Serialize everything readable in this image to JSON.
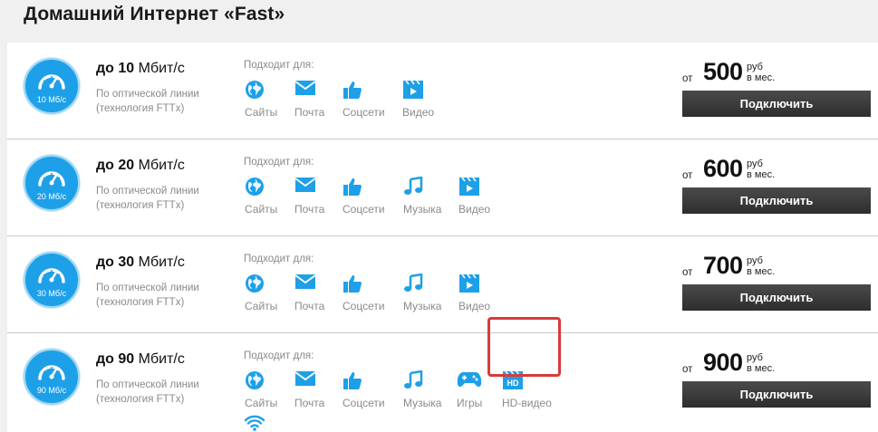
{
  "page": {
    "title": "Домашний Интернет «Fast»"
  },
  "colors": {
    "accent": "#1ea0e8",
    "button": "#3a3a3a",
    "highlight": "#d93a3a"
  },
  "plans": [
    {
      "badge": "10 Мб/с",
      "speed_prefix": "до",
      "speed_value": "10",
      "speed_unit": "Мбит/с",
      "desc": "По оптической линии (технология FTTx)",
      "suits_label": "Подходит для:",
      "features": [
        {
          "icon": "globe-icon",
          "label": "Сайты"
        },
        {
          "icon": "mail-icon",
          "label": "Почта"
        },
        {
          "icon": "thumbs-up-icon",
          "label": "Соцсети"
        },
        {
          "icon": "video-icon",
          "label": "Видео"
        }
      ],
      "price_from": "от",
      "price": "500",
      "price_unit": "руб",
      "price_period": "в мес.",
      "button": "Подключить"
    },
    {
      "badge": "20 Мб/с",
      "speed_prefix": "до",
      "speed_value": "20",
      "speed_unit": "Мбит/с",
      "desc": "По оптической линии (технология FTTx)",
      "suits_label": "Подходит для:",
      "features": [
        {
          "icon": "globe-icon",
          "label": "Сайты"
        },
        {
          "icon": "mail-icon",
          "label": "Почта"
        },
        {
          "icon": "thumbs-up-icon",
          "label": "Соцсети"
        },
        {
          "icon": "music-icon",
          "label": "Музыка"
        },
        {
          "icon": "video-icon",
          "label": "Видео"
        }
      ],
      "price_from": "от",
      "price": "600",
      "price_unit": "руб",
      "price_period": "в мес.",
      "button": "Подключить"
    },
    {
      "badge": "30 Мб/с",
      "speed_prefix": "до",
      "speed_value": "30",
      "speed_unit": "Мбит/с",
      "desc": "По оптической линии (технология FTTx)",
      "suits_label": "Подходит для:",
      "features": [
        {
          "icon": "globe-icon",
          "label": "Сайты"
        },
        {
          "icon": "mail-icon",
          "label": "Почта"
        },
        {
          "icon": "thumbs-up-icon",
          "label": "Соцсети"
        },
        {
          "icon": "music-icon",
          "label": "Музыка"
        },
        {
          "icon": "video-icon",
          "label": "Видео"
        }
      ],
      "price_from": "от",
      "price": "700",
      "price_unit": "руб",
      "price_period": "в мес.",
      "button": "Подключить"
    },
    {
      "badge": "90 Мб/с",
      "speed_prefix": "до",
      "speed_value": "90",
      "speed_unit": "Мбит/с",
      "desc": "По оптической линии (технология FTTx)",
      "suits_label": "Подходит для:",
      "features": [
        {
          "icon": "globe-icon",
          "label": "Сайты"
        },
        {
          "icon": "mail-icon",
          "label": "Почта"
        },
        {
          "icon": "thumbs-up-icon",
          "label": "Соцсети"
        },
        {
          "icon": "music-icon",
          "label": "Музыка"
        },
        {
          "icon": "gamepad-icon",
          "label": "Игры"
        },
        {
          "icon": "hd-video-icon",
          "label": "HD-видео"
        }
      ],
      "extra_icon": "wifi-icon",
      "price_from": "от",
      "price": "900",
      "price_unit": "руб",
      "price_period": "в мес.",
      "button": "Подключить"
    }
  ]
}
